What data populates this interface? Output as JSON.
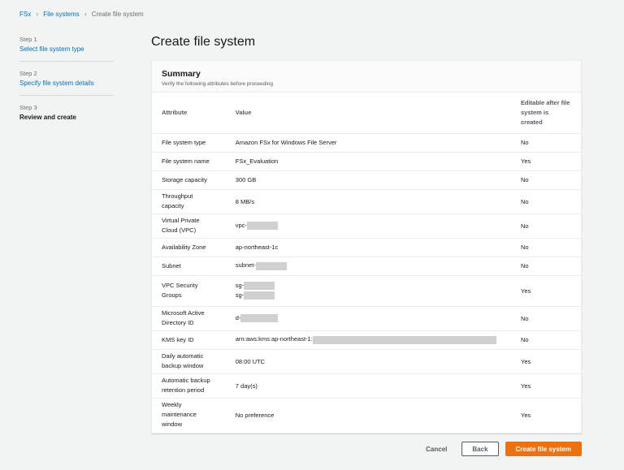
{
  "breadcrumb": {
    "items": [
      "FSx",
      "File systems"
    ],
    "current": "Create file system"
  },
  "sidebar": {
    "steps": [
      {
        "num": "Step 1",
        "label": "Select file system type"
      },
      {
        "num": "Step 2",
        "label": "Specify file system details"
      },
      {
        "num": "Step 3",
        "label": "Review and create"
      }
    ]
  },
  "page": {
    "title": "Create file system"
  },
  "summary": {
    "title": "Summary",
    "description": "Verify the following attributes before proceeding",
    "headers": {
      "attribute": "Attribute",
      "value": "Value",
      "editable": "Editable after file system is created"
    },
    "rows": [
      {
        "attr": "File system type",
        "value": "Amazon FSx for Windows File Server",
        "editable": "No"
      },
      {
        "attr": "File system name",
        "value": "FSx_Evaluation",
        "editable": "Yes"
      },
      {
        "attr": "Storage capacity",
        "value": "300 GB",
        "editable": "No"
      },
      {
        "attr": "Throughput capacity",
        "value": "8 MB/s",
        "editable": "No"
      },
      {
        "attr": "Virtual Private Cloud (VPC)",
        "value": "vpc-",
        "editable": "No"
      },
      {
        "attr": "Availability Zone",
        "value": "ap-northeast-1c",
        "editable": "No"
      },
      {
        "attr": "Subnet",
        "value": "subnet-",
        "editable": "No"
      },
      {
        "attr": "VPC Security Groups",
        "value": "sg-",
        "value2": "sg-",
        "editable": "Yes"
      },
      {
        "attr": "Microsoft Active Directory ID",
        "value": "d-",
        "editable": "No"
      },
      {
        "attr": "KMS key ID",
        "value": "arn:aws:kms:ap-northeast-1:",
        "editable": "No"
      },
      {
        "attr": "Daily automatic backup window",
        "value": "08:00 UTC",
        "editable": "Yes"
      },
      {
        "attr": "Automatic backup retention period",
        "value": "7 day(s)",
        "editable": "Yes"
      },
      {
        "attr": "Weekly maintenance window",
        "value": "No preference",
        "editable": "Yes"
      }
    ]
  },
  "footer": {
    "cancel": "Cancel",
    "back": "Back",
    "create": "Create file system"
  }
}
